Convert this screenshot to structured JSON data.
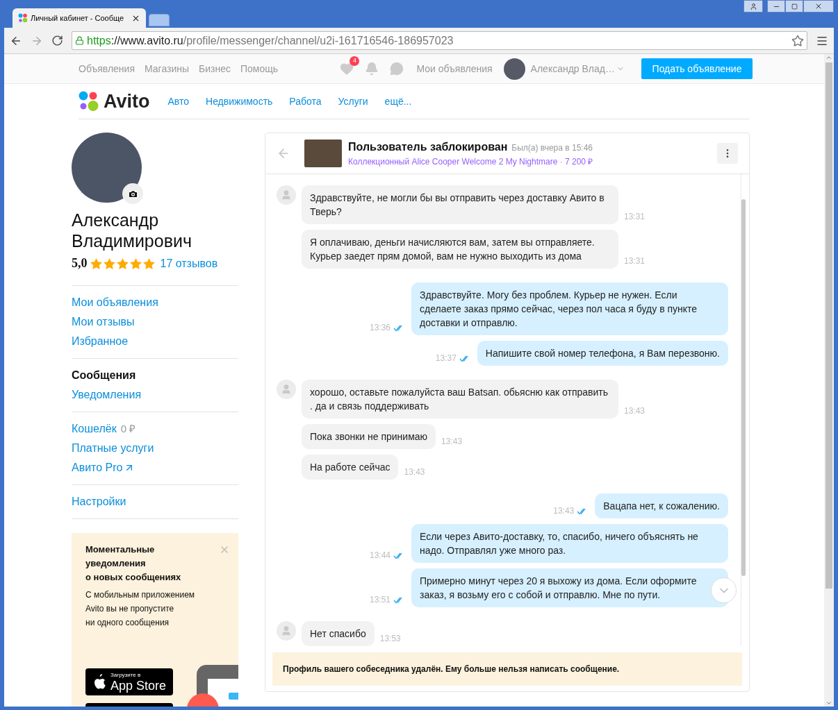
{
  "browser": {
    "tab_title": "Личный кабинет - Сообще",
    "url": {
      "scheme": "https",
      "host": "://www.avito.ru",
      "path": "/profile/messenger/channel/u2i-161716546-186957023"
    }
  },
  "top_nav": {
    "links": [
      "Объявления",
      "Магазины",
      "Бизнес",
      "Помощь"
    ],
    "favorites_badge": "4",
    "my_ads": "Мои объявления",
    "user_name": "Александр Влад…",
    "post_button": "Подать объявление"
  },
  "header": {
    "logo": "Avito",
    "categories": [
      "Авто",
      "Недвижимость",
      "Работа",
      "Услуги",
      "ещё..."
    ]
  },
  "profile": {
    "name": "Александр Владимирович",
    "rating": "5,0",
    "stars": 5,
    "reviews": "17 отзывов"
  },
  "menu_groups": [
    [
      {
        "label": "Мои объявления",
        "selected": false
      },
      {
        "label": "Мои отзывы",
        "selected": false
      },
      {
        "label": "Избранное",
        "selected": false
      }
    ],
    [
      {
        "label": "Сообщения",
        "selected": true
      },
      {
        "label": "Уведомления",
        "selected": false
      }
    ],
    [
      {
        "label": "Кошелёк",
        "selected": false,
        "extra": "0 ₽"
      },
      {
        "label": "Платные услуги",
        "selected": false
      },
      {
        "label": "Авито Pro",
        "selected": false,
        "external": true
      }
    ],
    [
      {
        "label": "Настройки",
        "selected": false
      }
    ]
  ],
  "promo": {
    "title_lines": [
      "Моментальные",
      "уведомления",
      "о новых сообщениях"
    ],
    "body_lines": [
      "С мобильным приложением",
      "Avito вы не пропустите",
      "ни одного сообщения"
    ],
    "store_caption": "Загрузите в",
    "store_name": "App Store"
  },
  "chat": {
    "title": "Пользователь заблокирован",
    "status": "Был(а) вчера в 15:46",
    "item": "Коллекционный Alice Cooper Welcome 2 My Nightmare · 7 200 ₽",
    "messages": [
      {
        "kind": "in",
        "show_avatar": true,
        "text": "Здравствуйте, не могли бы вы отправить через доставку Авито в Тверь?",
        "time": "13:31"
      },
      {
        "kind": "in",
        "show_avatar": false,
        "text": "Я оплачиваю, деньги начисляются вам, затем вы отправляете. Курьер заедет прям домой, вам не нужно выходить из дома",
        "time": "13:31"
      },
      {
        "kind": "out",
        "read": true,
        "text": "Здравствуйте. Могу без проблем. Курьер не нужен. Если сделаете заказ прямо сейчас, через пол часа я буду в пункте доставки и отправлю.",
        "time": "13:36"
      },
      {
        "kind": "out",
        "read": true,
        "text": "Напишите свой номер телефона, я Вам перезвоню.",
        "time": "13:37"
      },
      {
        "kind": "in",
        "show_avatar": true,
        "text": "хорошо, оставьте пожалуйста ваш Batsап. обьясню как отправить . да и связь поддерживать",
        "time": "13:43"
      },
      {
        "kind": "in",
        "show_avatar": false,
        "text": "Пока звонки не принимаю",
        "time": "13:43"
      },
      {
        "kind": "in",
        "show_avatar": false,
        "text": "На работе сейчас",
        "time": "13:43"
      },
      {
        "kind": "out",
        "read": true,
        "text": "Вацапа нет, к сожалению.",
        "time": "13:43"
      },
      {
        "kind": "out",
        "read": true,
        "text": "Если через Авито-доставку, то, спасибо, ничего объяснять не надо. Отправлял уже много раз.",
        "time": "13:44"
      },
      {
        "kind": "out",
        "read": true,
        "text": "Примерно минут через 20 я выхожу из дома. Если оформите заказ, я возьму его с собой и отправлю. Мне по пути.",
        "time": "13:51"
      },
      {
        "kind": "in",
        "show_avatar": true,
        "text": "Нет спасибо",
        "time": "13:53"
      }
    ],
    "notice": "Профиль вашего собеседника удалён. Ему больше нельзя написать сообщение."
  }
}
